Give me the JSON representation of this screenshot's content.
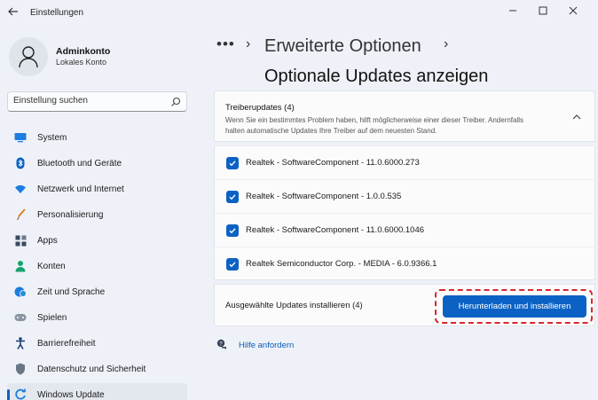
{
  "titlebar": {
    "back_icon": "back-arrow-icon",
    "app_title": "Einstellungen",
    "minimize_glyph": "–",
    "maximize_glyph": "☐",
    "close_glyph": "✕"
  },
  "user": {
    "name": "Adminkonto",
    "account_type": "Lokales Konto"
  },
  "search": {
    "placeholder": "Einstellung suchen"
  },
  "sidebar": {
    "items": [
      {
        "label": "System",
        "icon": "monitor-icon"
      },
      {
        "label": "Bluetooth und Geräte",
        "icon": "bluetooth-icon"
      },
      {
        "label": "Netzwerk und Internet",
        "icon": "wifi-icon"
      },
      {
        "label": "Personalisierung",
        "icon": "brush-icon"
      },
      {
        "label": "Apps",
        "icon": "apps-icon"
      },
      {
        "label": "Konten",
        "icon": "person-icon"
      },
      {
        "label": "Zeit und Sprache",
        "icon": "globe-clock-icon"
      },
      {
        "label": "Spielen",
        "icon": "gamepad-icon"
      },
      {
        "label": "Barrierefreiheit",
        "icon": "accessibility-icon"
      },
      {
        "label": "Datenschutz und Sicherheit",
        "icon": "shield-icon"
      },
      {
        "label": "Windows Update",
        "icon": "update-icon"
      }
    ],
    "active_index": 10
  },
  "breadcrumb": {
    "overflow": "•••",
    "separator": "›",
    "parent": "Erweiterte Optionen",
    "current": "Optionale Updates anzeigen"
  },
  "driver_updates": {
    "title": "Treiberupdates (4)",
    "description": "Wenn Sie ein bestimmtes Problem haben, hilft möglicherweise einer dieser Treiber. Andernfalls halten automatische Updates Ihre Treiber auf dem neuesten Stand.",
    "items": [
      {
        "label": "Realtek - SoftwareComponent - 11.0.6000.273",
        "checked": true
      },
      {
        "label": "Realtek - SoftwareComponent - 1.0.0.535",
        "checked": true
      },
      {
        "label": "Realtek - SoftwareComponent - 11.0.6000.1046",
        "checked": true
      },
      {
        "label": "Realtek Semiconductor Corp. - MEDIA - 6.0.9366.1",
        "checked": true
      }
    ]
  },
  "install": {
    "label": "Ausgewählte Updates installieren (4)",
    "button_label": "Herunterladen und installieren"
  },
  "help": {
    "label": "Hilfe anfordern"
  },
  "colors": {
    "accent": "#0b62c4",
    "highlight": "#d9272e",
    "background": "#eef2f8"
  }
}
